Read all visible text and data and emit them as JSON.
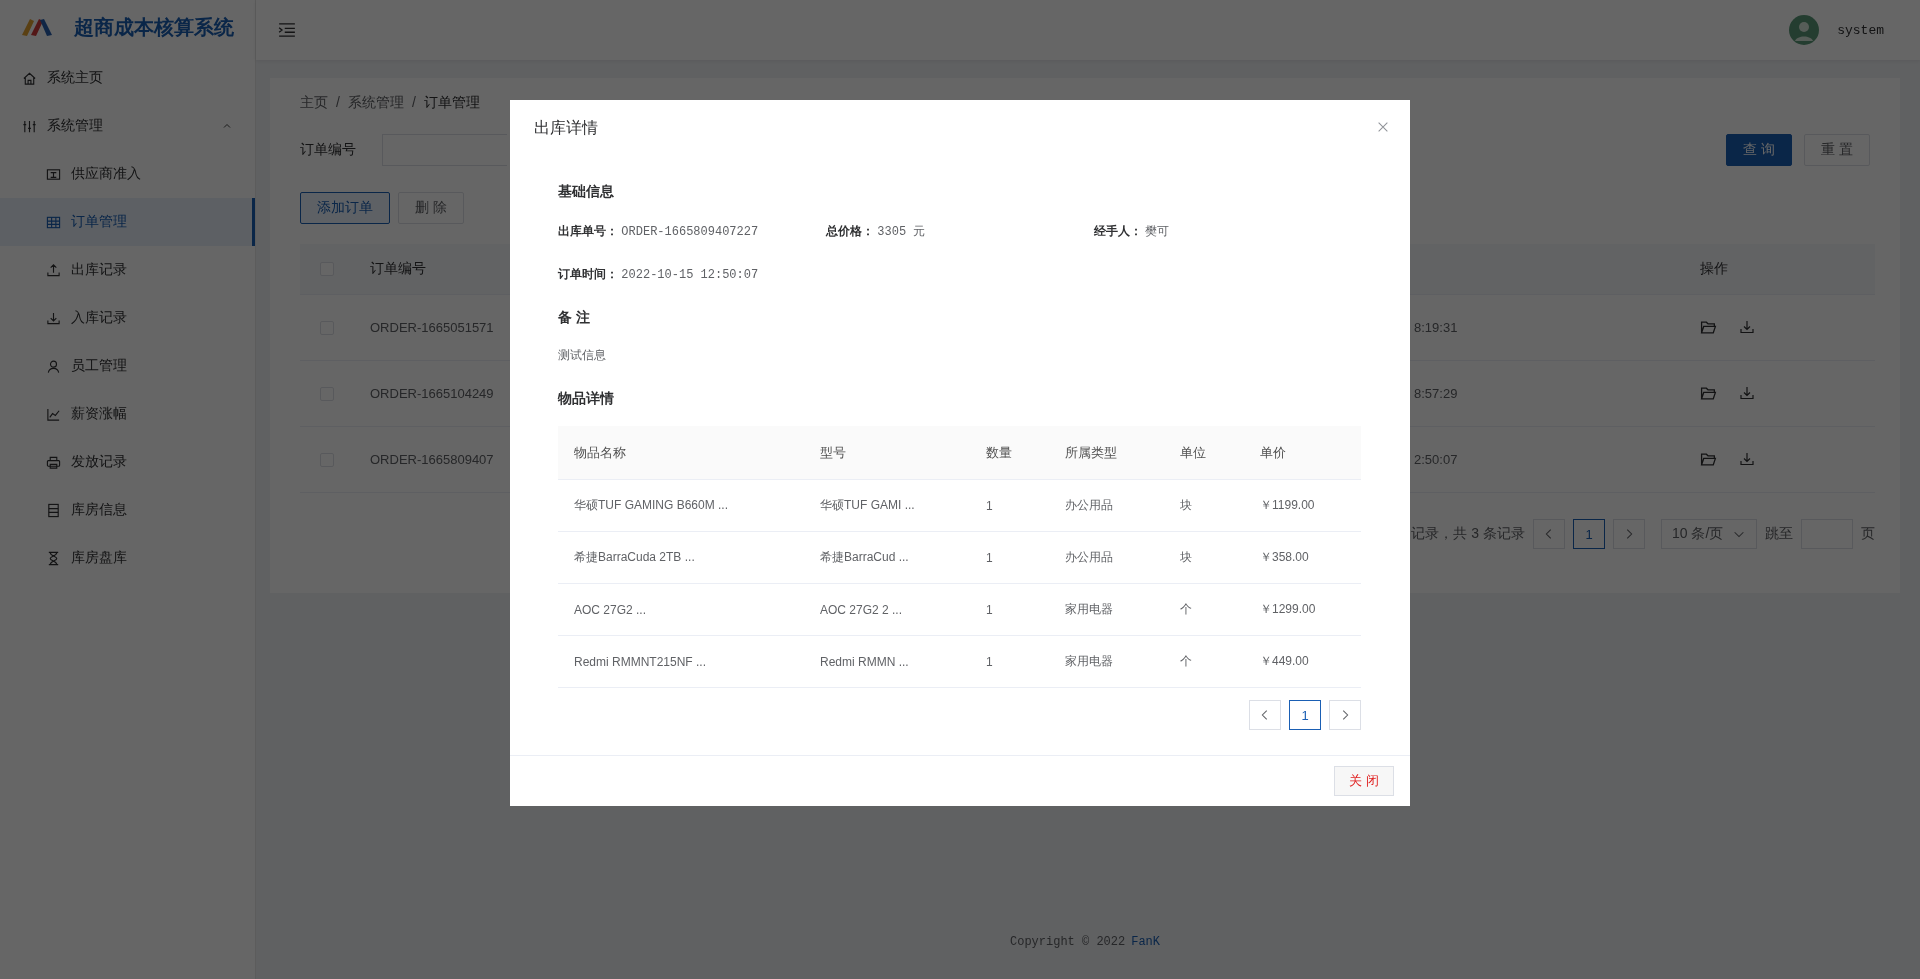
{
  "app": {
    "title": "超商成本核算系统"
  },
  "sidebar": {
    "items": [
      {
        "label": "系统主页",
        "selected": false
      },
      {
        "label": "系统管理",
        "selected": false,
        "expanded": true,
        "children": [
          {
            "label": "供应商准入",
            "selected": false
          },
          {
            "label": "订单管理",
            "selected": true
          },
          {
            "label": "出库记录",
            "selected": false
          },
          {
            "label": "入库记录",
            "selected": false
          },
          {
            "label": "员工管理",
            "selected": false
          },
          {
            "label": "薪资涨幅",
            "selected": false
          },
          {
            "label": "发放记录",
            "selected": false
          },
          {
            "label": "库房信息",
            "selected": false
          },
          {
            "label": "库房盘库",
            "selected": false
          }
        ]
      }
    ]
  },
  "header": {
    "user": "system"
  },
  "breadcrumb": {
    "separator": "/",
    "items": [
      "主页",
      "系统管理",
      "订单管理"
    ]
  },
  "search": {
    "label": "订单编号",
    "buttons": [
      {
        "label": "查 询",
        "kind": "primary"
      },
      {
        "label": "重 置",
        "kind": "default"
      }
    ]
  },
  "actions": [
    {
      "label": "添加订单",
      "kind": "outline"
    },
    {
      "label": "删 除",
      "kind": "default"
    }
  ],
  "table": {
    "header_checked": false,
    "columns": [
      "订单编号",
      "操作"
    ],
    "rows": [
      {
        "checked": false,
        "order_no": "ORDER-1665051571",
        "time": "8:19:31"
      },
      {
        "checked": false,
        "order_no": "ORDER-1665104249",
        "time": "8:57:29"
      },
      {
        "checked": false,
        "order_no": "ORDER-1665809407",
        "time": "2:50:07"
      }
    ]
  },
  "pagination": {
    "summary": "记录，共 3 条记录",
    "pages": [
      {
        "label": "1",
        "selected": true
      }
    ],
    "page_size": "10 条/页",
    "jump_label": "跳至",
    "page_suffix": "页"
  },
  "footer": {
    "copyright": "Copyright © 2022",
    "author": "FanK"
  },
  "dialog": {
    "title": "出库详情",
    "basic": {
      "heading": "基础信息",
      "fields": [
        {
          "label": "出库单号：",
          "value": "ORDER-1665809407227"
        },
        {
          "label": "总价格：",
          "value": "3305 元"
        },
        {
          "label": "经手人：",
          "value": "樊可"
        },
        {
          "label": "订单时间：",
          "value": "2022-10-15 12:50:07"
        }
      ]
    },
    "remark": {
      "heading": "备 注",
      "text": "测试信息"
    },
    "items": {
      "heading": "物品详情",
      "columns": [
        "物品名称",
        "型号",
        "数量",
        "所属类型",
        "单位",
        "单价"
      ],
      "rows": [
        [
          "华硕TUF GAMING B660M ...",
          "华硕TUF GAMI ...",
          "1",
          "办公用品",
          "块",
          "￥1199.00"
        ],
        [
          "希捷BarraCuda 2TB ...",
          "希捷BarraCud ...",
          "1",
          "办公用品",
          "块",
          "￥358.00"
        ],
        [
          "AOC 27G2 ...",
          "AOC 27G2 2 ...",
          "1",
          "家用电器",
          "个",
          "￥1299.00"
        ],
        [
          "Redmi RMMNT215NF ...",
          "Redmi RMMN ...",
          "1",
          "家用电器",
          "个",
          "￥449.00"
        ]
      ]
    },
    "pagination": {
      "pages": [
        {
          "label": "1",
          "selected": true
        }
      ]
    },
    "close_button": "关 闭"
  }
}
